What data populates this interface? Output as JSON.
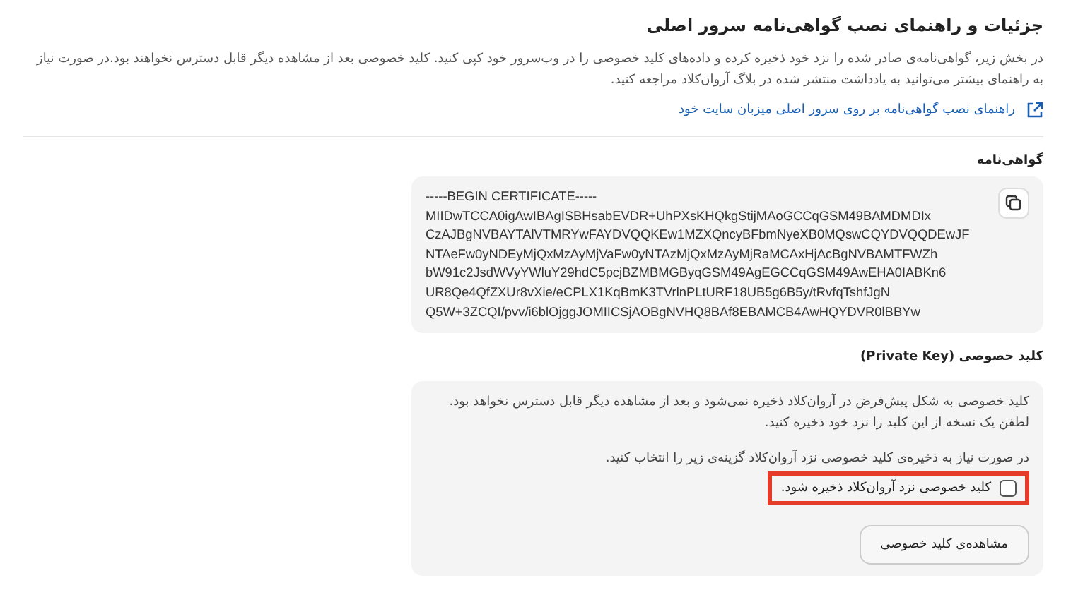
{
  "header": {
    "title": "جزئیات و راهنمای نصب گواهی‌نامه سرور اصلی",
    "description": "در بخش زیر، گواهی‌نامه‌ی صادر شده را نزد خود ذخیره کرده و داده‌های کلید خصوصی را در وب‌سرور خود کپی کنید. کلید خصوصی بعد از مشاهده دیگر قابل دسترس نخواهند بود.در صورت نیاز به راهنمای بیشتر می‌توانید به یادداشت منتشر شده در بلاگ آروان‌کلاد مراجعه کنید.",
    "link": "راهنمای نصب گواهی‌نامه بر روی سرور اصلی میزبان سایت خود"
  },
  "certificate": {
    "label": "گواهی‌نامه",
    "lines": [
      "-----BEGIN CERTIFICATE-----",
      "MIIDwTCCA0igAwIBAgISBHsabEVDR+UhPXsKHQkgStijMAoGCCqGSM49BAMDMDIx",
      "CzAJBgNVBAYTAlVTMRYwFAYDVQQKEw1MZXQncyBFbmNyeXB0MQswCQYDVQQDEwJF",
      "NTAeFw0yNDEyMjQxMzAyMjVaFw0yNTAzMjQxMzAyMjRaMCAxHjAcBgNVBAMTFWZh",
      "bW91c2JsdWVyYWluY29hdC5pcjBZMBMGByqGSM49AgEGCCqGSM49AwEHA0IABKn6",
      "UR8Qe4QfZXUr8vXie/eCPLX1KqBmK3TVrlnPLtURF18UB5g6B5y/tRvfqTshfJgN",
      "Q5W+3ZCQI/pvv/i6blOjggJOMIICSjAOBgNVHQ8BAf8EBAMCB4AwHQYDVR0lBBYw"
    ]
  },
  "private_key": {
    "label": "کلید خصوصی  (Private Key)",
    "notice": "کلید خصوصی به شکل پیش‌فرض در آروان‌کلاد ذخیره نمی‌شود و بعد از مشاهده دیگر قابل دسترس نخواهد بود. لطفن یک نسخه از این کلید را نزد خود ذخیره کنید.",
    "hint": "در صورت نیاز به ذخیره‌ی کلید خصوصی نزد آروان‌کلاد گزینه‌ی زیر را انتخاب کنید.",
    "checkbox": {
      "label": "کلید خصوصی نزد آروان‌کلاد ذخیره شود.",
      "checked": false,
      "highlighted": true
    },
    "button": "مشاهده‌ی کلید خصوصی"
  }
}
